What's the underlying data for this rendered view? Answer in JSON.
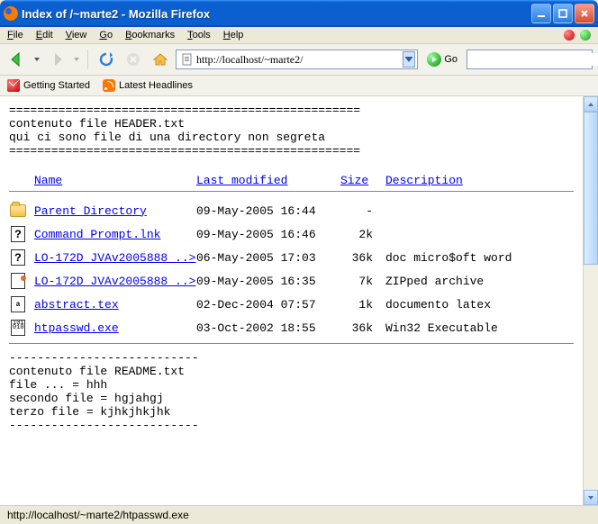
{
  "window": {
    "title": "Index of /~marte2 - Mozilla Firefox"
  },
  "menu": {
    "file": "File",
    "edit": "Edit",
    "view": "View",
    "go": "Go",
    "bookmarks": "Bookmarks",
    "tools": "Tools",
    "help": "Help"
  },
  "toolbar": {
    "url": "http://localhost/~marte2/",
    "go_label": "Go",
    "search_value": ""
  },
  "bookmarks": {
    "getting_started": "Getting Started",
    "latest_headlines": "Latest Headlines"
  },
  "header_block": "==================================================\ncontenuto file HEADER.txt\nqui ci sono file di una directory non segreta\n==================================================",
  "columns": {
    "name": "Name",
    "modified": "Last modified",
    "size": "Size",
    "desc": "Description"
  },
  "files": [
    {
      "icon": "folder",
      "name": "Parent Directory",
      "date": "09-May-2005 16:44",
      "size": "-",
      "desc": ""
    },
    {
      "icon": "unknown",
      "name": "Command Prompt.lnk",
      "date": "09-May-2005 16:46",
      "size": "2k",
      "desc": ""
    },
    {
      "icon": "unknown",
      "name": "LO-172D JVAv2005888 ..>",
      "date": "06-May-2005 17:03",
      "size": "36k",
      "desc": "doc micro$oft word"
    },
    {
      "icon": "zip",
      "name": "LO-172D JVAv2005888 ..>",
      "date": "09-May-2005 16:35",
      "size": "7k",
      "desc": "ZIPped archive"
    },
    {
      "icon": "tex",
      "name": "abstract.tex",
      "date": "02-Dec-2004 07:57",
      "size": "1k",
      "desc": "documento latex"
    },
    {
      "icon": "exe",
      "name": "htpasswd.exe",
      "date": "03-Oct-2002 18:55",
      "size": "36k",
      "desc": "Win32 Executable"
    }
  ],
  "readme_block": "---------------------------\ncontenuto file README.txt\nfile ... = hhh\nsecondo file = hgjahgj\nterzo file = kjhkjhkjhk\n---------------------------",
  "statusbar": {
    "text": "http://localhost/~marte2/htpasswd.exe"
  }
}
